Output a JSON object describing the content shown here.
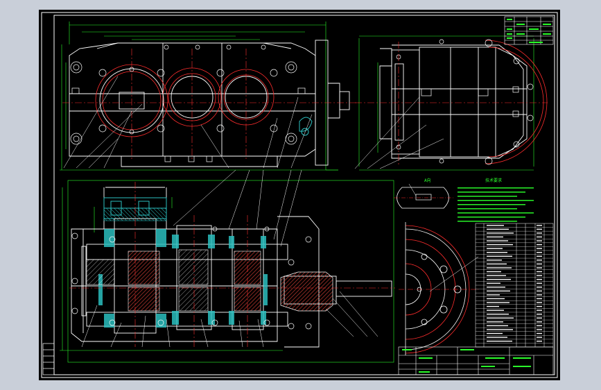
{
  "viewer": {
    "background_color": "#c9cfd9",
    "paper_color": "#000000",
    "border_color": "#ffffff"
  },
  "colors": {
    "outline": "#ffffff",
    "centerline": "#ff2d2d",
    "dimension": "#2bff2b",
    "section_fill": "#2bbfbf",
    "hatch_dark": "#e04a3a",
    "text_note": "#2bff2b",
    "leader": "#ffffff"
  },
  "drawing": {
    "front_view": "gearbox-front-view",
    "side_view": "gearbox-side-view",
    "section_view": "gearbox-longitudinal-section",
    "flange_view": "output-flange-partial-view",
    "detail_view": "keyway-detail"
  },
  "tech_notes_header": "技术要求",
  "detail_label": "A向",
  "title_block": {
    "top_table_rows": 6,
    "parts_list_rows": 32,
    "revision_rows": 5
  }
}
